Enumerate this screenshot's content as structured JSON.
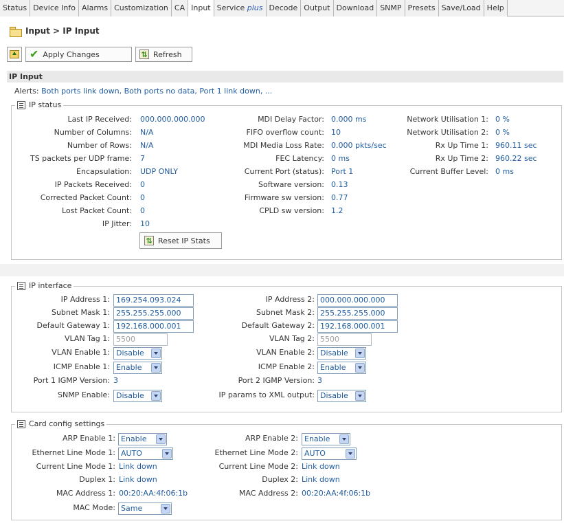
{
  "tabs": [
    {
      "label": "Status"
    },
    {
      "label": "Device Info"
    },
    {
      "label": "Alarms"
    },
    {
      "label": "Customization"
    },
    {
      "label": "CA"
    },
    {
      "label": "Input"
    },
    {
      "label": "Service",
      "suffix": "plus"
    },
    {
      "label": "Decode"
    },
    {
      "label": "Output"
    },
    {
      "label": "Download"
    },
    {
      "label": "SNMP"
    },
    {
      "label": "Presets"
    },
    {
      "label": "Save/Load"
    },
    {
      "label": "Help"
    }
  ],
  "active_tab": "Input",
  "page_title": "Input > IP Input",
  "toolbar": {
    "apply_label": "Apply Changes",
    "refresh_label": "Refresh"
  },
  "section_title": "IP Input",
  "alerts": {
    "label": "Alerts:",
    "text": "Both ports link down, Both ports no data, Port 1 link down, ..."
  },
  "ip_status": {
    "legend": "IP status",
    "col1": [
      {
        "label": "Last IP Received:",
        "value": "000.000.000.000"
      },
      {
        "label": "Number of Columns:",
        "value": "N/A"
      },
      {
        "label": "Number of Rows:",
        "value": "N/A"
      },
      {
        "label": "TS packets per UDP frame:",
        "value": "7"
      },
      {
        "label": "Encapsulation:",
        "value": "UDP ONLY"
      },
      {
        "label": "IP Packets Received:",
        "value": "0"
      },
      {
        "label": "Corrected Packet Count:",
        "value": "0"
      },
      {
        "label": "Lost Packet Count:",
        "value": "0"
      },
      {
        "label": "IP Jitter:",
        "value": "10"
      }
    ],
    "col2": [
      {
        "label": "MDI Delay Factor:",
        "value": "0.000 ms"
      },
      {
        "label": "FIFO overflow count:",
        "value": "10"
      },
      {
        "label": "MDI Media Loss Rate:",
        "value": "0.000 pkts/sec"
      },
      {
        "label": "FEC Latency:",
        "value": "0 ms"
      },
      {
        "label": "Current Port (status):",
        "value": "Port 1"
      },
      {
        "label": "Software version:",
        "value": "0.13"
      },
      {
        "label": "Firmware sw version:",
        "value": "0.77"
      },
      {
        "label": "CPLD sw version:",
        "value": "1.2"
      }
    ],
    "col3": [
      {
        "label": "Network Utilisation 1:",
        "value": "0 %"
      },
      {
        "label": "Network Utilisation 2:",
        "value": "0 %"
      },
      {
        "label": "Rx Up Time 1:",
        "value": "960.11 sec"
      },
      {
        "label": "Rx Up Time 2:",
        "value": "960.22 sec"
      },
      {
        "label": "Current Buffer Level:",
        "value": "0 ms"
      }
    ],
    "reset_label": "Reset IP Stats"
  },
  "ip_interface": {
    "legend": "IP interface",
    "left": {
      "ip_label": "IP Address 1:",
      "ip_value": "169.254.093.024",
      "mask_label": "Subnet Mask 1:",
      "mask_value": "255.255.255.000",
      "gw_label": "Default Gateway 1:",
      "gw_value": "192.168.000.001",
      "vlan_tag_label": "VLAN Tag 1:",
      "vlan_tag_value": "5500",
      "vlan_en_label": "VLAN Enable 1:",
      "vlan_en_value": "Disable",
      "icmp_label": "ICMP Enable 1:",
      "icmp_value": "Enable",
      "igmp_label": "Port 1 IGMP Version:",
      "igmp_value": "3",
      "snmp_label": "SNMP Enable:",
      "snmp_value": "Disable"
    },
    "right": {
      "ip_label": "IP Address 2:",
      "ip_value": "000.000.000.000",
      "mask_label": "Subnet Mask 2:",
      "mask_value": "255.255.255.000",
      "gw_label": "Default Gateway 2:",
      "gw_value": "192.168.000.001",
      "vlan_tag_label": "VLAN Tag 2:",
      "vlan_tag_value": "5500",
      "vlan_en_label": "VLAN Enable 2:",
      "vlan_en_value": "Disable",
      "icmp_label": "ICMP Enable 2:",
      "icmp_value": "Enable",
      "igmp_label": "Port 2 IGMP Version:",
      "igmp_value": "3",
      "xml_label": "IP params to XML output:",
      "xml_value": "Disable"
    }
  },
  "card_config": {
    "legend": "Card config settings",
    "left": {
      "arp_label": "ARP Enable 1:",
      "arp_value": "Enable",
      "eth_label": "Ethernet Line Mode 1:",
      "eth_value": "AUTO",
      "cur_label": "Current Line Mode 1:",
      "cur_value": "Link down",
      "dup_label": "Duplex 1:",
      "dup_value": "Link down",
      "mac_label": "MAC Address 1:",
      "mac_value": "00:20:AA:4f:06:1b",
      "macmode_label": "MAC Mode:",
      "macmode_value": "Same"
    },
    "right": {
      "arp_label": "ARP Enable 2:",
      "arp_value": "Enable",
      "eth_label": "Ethernet Line Mode 2:",
      "eth_value": "AUTO",
      "cur_label": "Current Line Mode 2:",
      "cur_value": "Link down",
      "dup_label": "Duplex 2:",
      "dup_value": "Link down",
      "mac_label": "MAC Address 2:",
      "mac_value": "00:20:AA:4f:06:1b"
    }
  }
}
